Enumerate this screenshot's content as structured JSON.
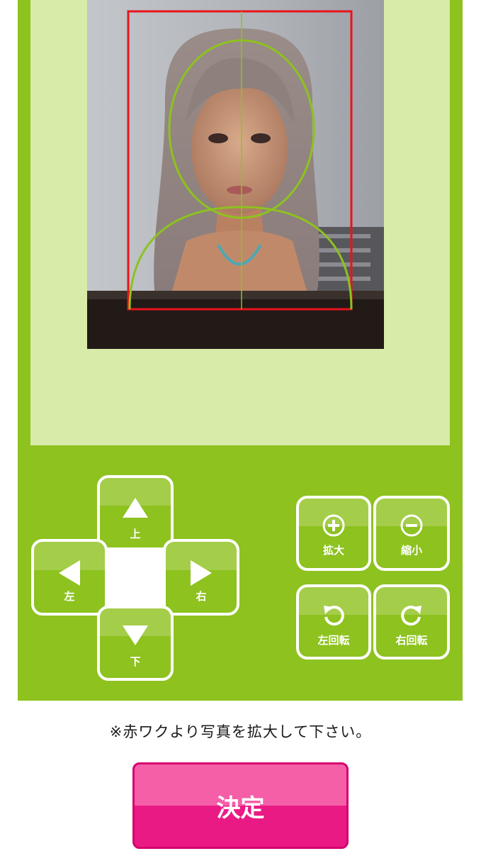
{
  "editor": {
    "photo_alt": "uploaded portrait photo",
    "guide_colors": {
      "frame": "#e8141c",
      "face": "#8dc21f"
    }
  },
  "dpad": {
    "up": "上",
    "left": "左",
    "right": "右",
    "down": "下"
  },
  "zoom": {
    "in": "拡大",
    "out": "縮小"
  },
  "rotate": {
    "left": "左回転",
    "right": "右回転"
  },
  "note": "※赤ワクより写真を拡大して下さい。",
  "submit_label": "決定",
  "colors": {
    "panel": "#8dc21f",
    "preview_bg": "#d8eba8",
    "submit": "#ea1a85"
  }
}
